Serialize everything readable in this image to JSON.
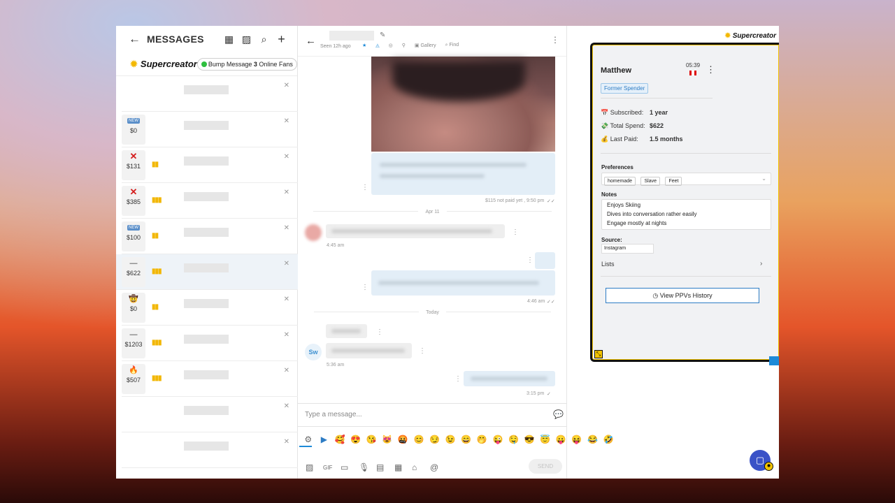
{
  "left": {
    "title": "MESSAGES",
    "brand": "Supercreator",
    "bump_prefix": "Bump Message",
    "bump_count": "3",
    "bump_suffix": "Online Fans",
    "rows": [
      {
        "icon": "",
        "amount": "",
        "bars": ""
      },
      {
        "icon": "NEW",
        "amount": "$0",
        "bars": ""
      },
      {
        "icon": "✕",
        "amount": "$131",
        "bars": "▮▮"
      },
      {
        "icon": "✕",
        "amount": "$385",
        "bars": "▮▮▮"
      },
      {
        "icon": "NEW",
        "amount": "$100",
        "bars": "▮▮"
      },
      {
        "icon": "—",
        "amount": "$622",
        "bars": "▮▮▮"
      },
      {
        "icon": "🤠",
        "amount": "$0",
        "bars": "▮▮"
      },
      {
        "icon": "—",
        "amount": "$1203",
        "bars": "▮▮▮"
      },
      {
        "icon": "🔥",
        "amount": "$507",
        "bars": "▮▮▮"
      },
      {
        "icon": "",
        "amount": "",
        "bars": ""
      },
      {
        "icon": "",
        "amount": "",
        "bars": ""
      }
    ]
  },
  "chat": {
    "seen": "Seen 12h ago",
    "tools": {
      "gallery": "Gallery",
      "find": "Find"
    },
    "msg1_meta": "$115 not paid yet , 9:50 pm",
    "date1": "Apr 11",
    "msg2_time": "4:45 am",
    "msg3_time": "4:46 am",
    "date2": "Today",
    "avatar_initials": "Sw",
    "msg4_time": "5:36 am",
    "msg5_time": "3:15 pm",
    "placeholder": "Type a message...",
    "send": "SEND",
    "emojis": [
      "🥰",
      "😍",
      "😘",
      "😻",
      "🤬",
      "😊",
      "😏",
      "😉",
      "😄",
      "🤭",
      "😜",
      "🤤",
      "😎",
      "😇",
      "😛",
      "😝",
      "😂",
      "🤣"
    ]
  },
  "fan": {
    "logo": "Supercreator",
    "name": "Matthew",
    "time": "05:39",
    "tag": "Former Spender",
    "subscribed_label": "📅 Subscribed:",
    "subscribed_value": "1 year",
    "spend_label": "💸 Total Spend:",
    "spend_value": "$622",
    "paid_label": "💰 Last Paid:",
    "paid_value": "1.5 months",
    "preferences_label": "Preferences",
    "preferences": [
      "homemade",
      "Slave",
      "Feet"
    ],
    "notes_label": "Notes",
    "notes": [
      "Enjoys Skiing",
      "Dives into conversation rather easily",
      "Engage mostly at nights"
    ],
    "source_label": "Source:",
    "source_value": "Instagram",
    "lists_label": "Lists",
    "ppv_button": "View PPVs History"
  }
}
